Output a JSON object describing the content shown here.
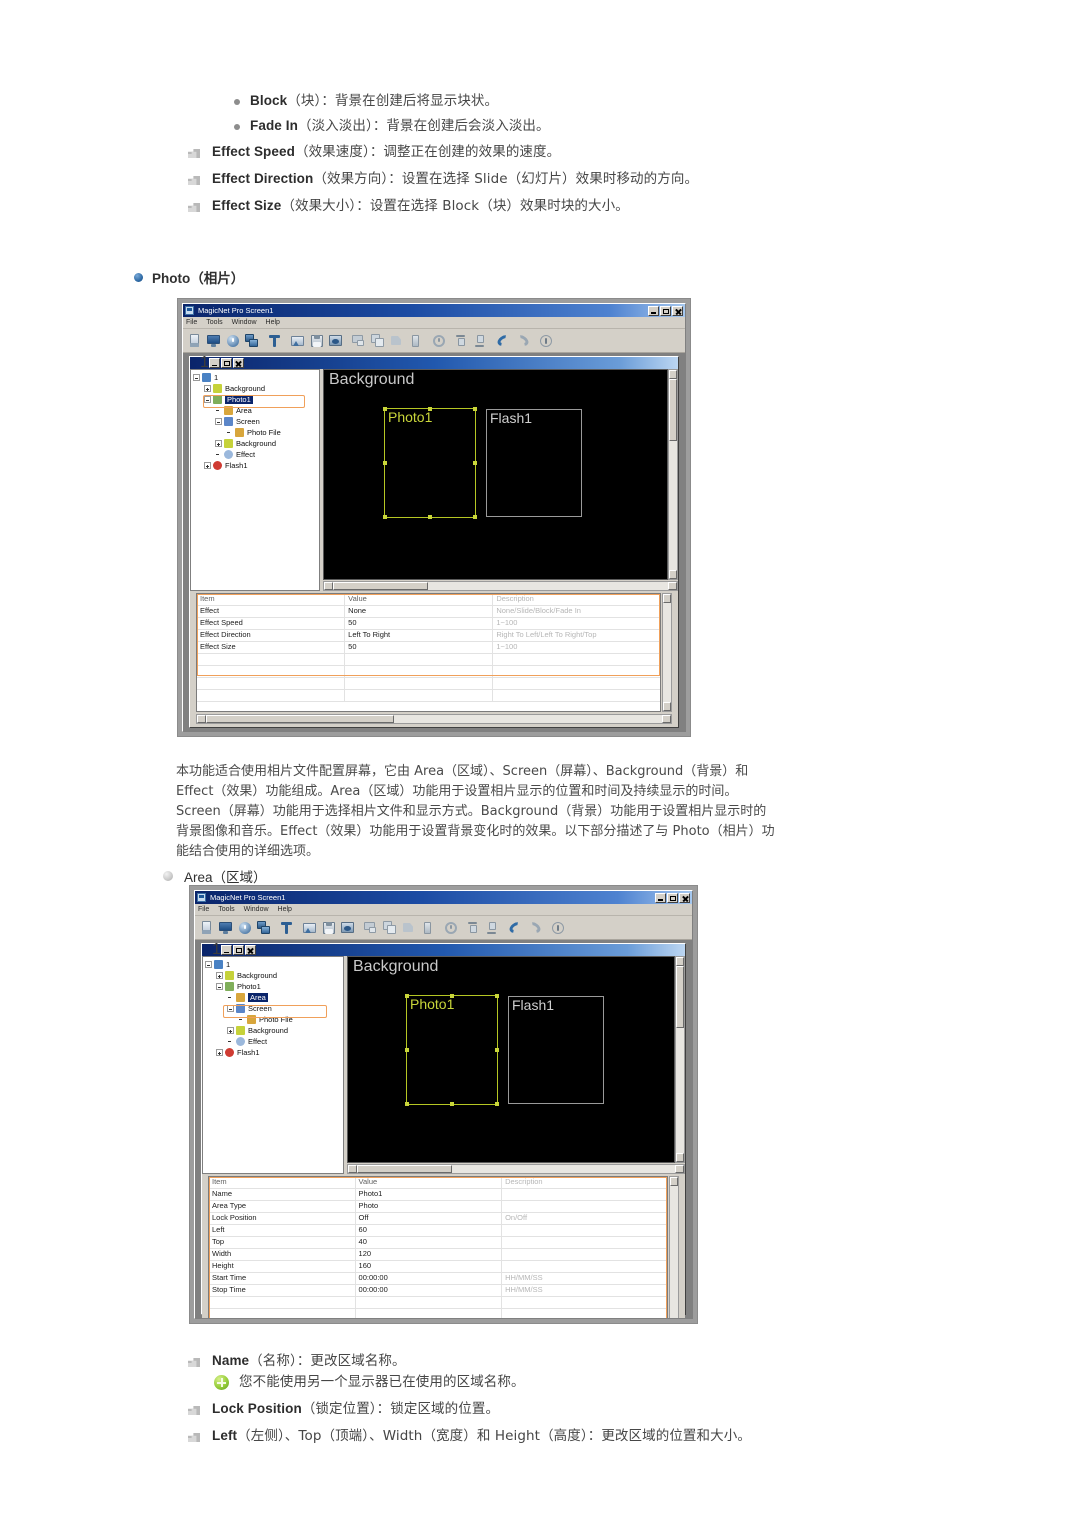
{
  "top_list": {
    "sub_bullets": [
      {
        "en": "Block",
        "cn": "（块）：背景在创建后将显示块状。"
      },
      {
        "en": "Fade In",
        "cn": "（淡入淡出）：背景在创建后会淡入淡出。"
      }
    ],
    "items": [
      {
        "en": "Effect Speed",
        "cn": "（效果速度）：调整正在创建的效果的速度。"
      },
      {
        "en": "Effect Direction",
        "cn": "（效果方向）：设置在选择 Slide（幻灯片）效果时移动的方向。"
      },
      {
        "en": "Effect Size",
        "cn": "（效果大小）：设置在选择 Block（块）效果时块的大小。"
      }
    ]
  },
  "photo_section": {
    "heading_en": "Photo",
    "heading_cn": "（相片）",
    "paragraph": "本功能适合使用相片文件配置屏幕，它由 Area（区域）、Screen（屏幕）、Background（背景）和 Effect（效果）功能组成。Area（区域）功能用于设置相片显示的位置和时间及持续显示的时间。Screen（屏幕）功能用于选择相片文件和显示方式。Background（背景）功能用于设置相片显示时的背景图像和音乐。Effect（效果）功能用于设置背景变化时的效果。以下部分描述了与 Photo（相片）功能结合使用的详细选项。"
  },
  "area_section": {
    "heading_en": "Area",
    "heading_cn": "（区域）",
    "bullets": [
      {
        "en": "Name",
        "cn": "（名称）：更改区域名称。"
      },
      {
        "en": "Lock Position",
        "cn": "（锁定位置）：锁定区域的位置。"
      },
      {
        "en": "Left",
        "cn": "（左侧）、Top（顶端）、Width（宽度）和 Height（高度）：更改区域的位置和大小。"
      }
    ],
    "note": "您不能使用另一个显示器已在使用的区域名称。"
  },
  "app": {
    "title": "MagicNet Pro Screen1",
    "menu": [
      "File",
      "Tools",
      "Window",
      "Help"
    ],
    "window_buttons": [
      "minimize",
      "maximize",
      "close"
    ],
    "toolbar_icons": [
      "new-screen-icon",
      "monitor-icon",
      "clock-icon",
      "layers-icon",
      "text-tool-icon",
      "image-tool-icon",
      "save-icon",
      "photo-icon",
      "cut-icon",
      "copy-icon",
      "paste-icon",
      "delete-icon",
      "clock2-icon",
      "align-top-icon",
      "align-bottom-icon",
      "undo-icon",
      "redo-icon",
      "info-icon"
    ],
    "mdi_title": "1",
    "canvas": {
      "background_label": "Background",
      "photo_label": "Photo1",
      "flash_label": "Flash1"
    }
  },
  "shot1": {
    "tree": [
      {
        "label": "1",
        "depth": 0,
        "icon": "root-icon",
        "expander": "minus",
        "selected": false
      },
      {
        "label": "Background",
        "depth": 1,
        "icon": "background-icon",
        "expander": "plus",
        "selected": false
      },
      {
        "label": "Photo1",
        "depth": 1,
        "icon": "photo-icon",
        "expander": "minus",
        "selected": true
      },
      {
        "label": "Area",
        "depth": 2,
        "icon": "area-icon",
        "expander": "none",
        "selected": false
      },
      {
        "label": "Screen",
        "depth": 2,
        "icon": "screen-icon",
        "expander": "minus",
        "selected": false
      },
      {
        "label": "Photo File",
        "depth": 3,
        "icon": "file-icon",
        "expander": "none",
        "selected": false
      },
      {
        "label": "Background",
        "depth": 2,
        "icon": "background-icon",
        "expander": "plus",
        "selected": false
      },
      {
        "label": "Effect",
        "depth": 2,
        "icon": "effect-icon",
        "expander": "none",
        "selected": false
      },
      {
        "label": "Flash1",
        "depth": 1,
        "icon": "flash-icon",
        "expander": "plus",
        "selected": false
      }
    ],
    "property_grid": {
      "headers": [
        "Item",
        "Value",
        "Description"
      ],
      "rows": [
        {
          "item": "Effect",
          "value": "None",
          "desc": "None/Slide/Block/Fade In"
        },
        {
          "item": "Effect Speed",
          "value": "50",
          "desc": "1~100"
        },
        {
          "item": "Effect Direction",
          "value": "Left To Right",
          "desc": "Right To Left/Left To Right/Top"
        },
        {
          "item": "Effect Size",
          "value": "50",
          "desc": "1~100"
        }
      ]
    }
  },
  "shot2": {
    "tree": [
      {
        "label": "1",
        "depth": 0,
        "icon": "root-icon",
        "expander": "minus",
        "selected": false
      },
      {
        "label": "Background",
        "depth": 1,
        "icon": "background-icon",
        "expander": "plus",
        "selected": false
      },
      {
        "label": "Photo1",
        "depth": 1,
        "icon": "photo-icon",
        "expander": "minus",
        "selected": false
      },
      {
        "label": "Area",
        "depth": 2,
        "icon": "area-icon",
        "expander": "none",
        "selected": true
      },
      {
        "label": "Screen",
        "depth": 2,
        "icon": "screen-icon",
        "expander": "minus",
        "selected": false
      },
      {
        "label": "Photo File",
        "depth": 3,
        "icon": "file-icon",
        "expander": "none",
        "selected": false
      },
      {
        "label": "Background",
        "depth": 2,
        "icon": "background-icon",
        "expander": "plus",
        "selected": false
      },
      {
        "label": "Effect",
        "depth": 2,
        "icon": "effect-icon",
        "expander": "none",
        "selected": false
      },
      {
        "label": "Flash1",
        "depth": 1,
        "icon": "flash-icon",
        "expander": "plus",
        "selected": false
      }
    ],
    "property_grid": {
      "headers": [
        "Item",
        "Value",
        "Description"
      ],
      "rows": [
        {
          "item": "Name",
          "value": "Photo1",
          "desc": ""
        },
        {
          "item": "Area Type",
          "value": "Photo",
          "desc": ""
        },
        {
          "item": "Lock Position",
          "value": "Off",
          "desc": "On/Off"
        },
        {
          "item": "Left",
          "value": "60",
          "desc": ""
        },
        {
          "item": "Top",
          "value": "40",
          "desc": ""
        },
        {
          "item": "Width",
          "value": "120",
          "desc": ""
        },
        {
          "item": "Height",
          "value": "160",
          "desc": ""
        },
        {
          "item": "Start Time",
          "value": "00:00:00",
          "desc": "HH/MM/SS"
        },
        {
          "item": "Stop Time",
          "value": "00:00:00",
          "desc": "HH/MM/SS"
        }
      ]
    }
  },
  "colors": {
    "highlight_orange": "#f0a05a",
    "selection_blue": "#0a246a",
    "canvas_black": "#000000",
    "photo_green": "#c9d63a"
  }
}
